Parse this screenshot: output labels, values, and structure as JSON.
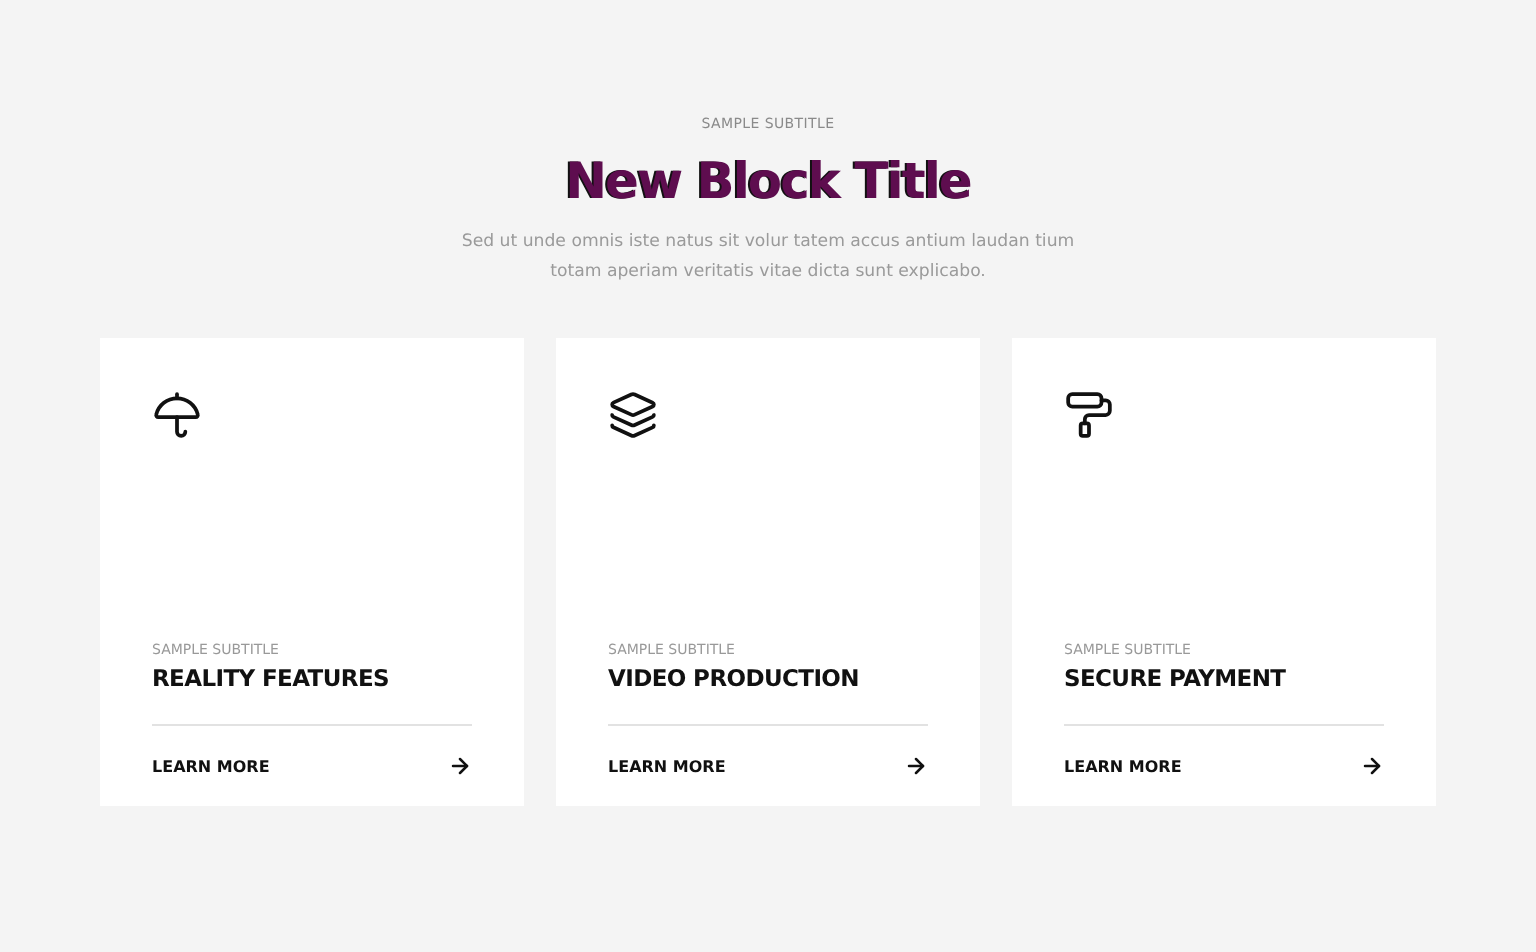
{
  "header": {
    "subtitle": "SAMPLE SUBTITLE",
    "title": "New Block Title",
    "description": "Sed ut unde omnis iste natus sit volur tatem accus antium laudan tium totam aperiam veritatis vitae dicta sunt explicabo."
  },
  "cards": [
    {
      "subtitle": "SAMPLE SUBTITLE",
      "title": "REALITY FEATURES",
      "link": "LEARN MORE"
    },
    {
      "subtitle": "SAMPLE SUBTITLE",
      "title": "VIDEO PRODUCTION",
      "link": "LEARN MORE"
    },
    {
      "subtitle": "SAMPLE SUBTITLE",
      "title": "SECURE PAYMENT",
      "link": "LEARN MORE"
    }
  ]
}
